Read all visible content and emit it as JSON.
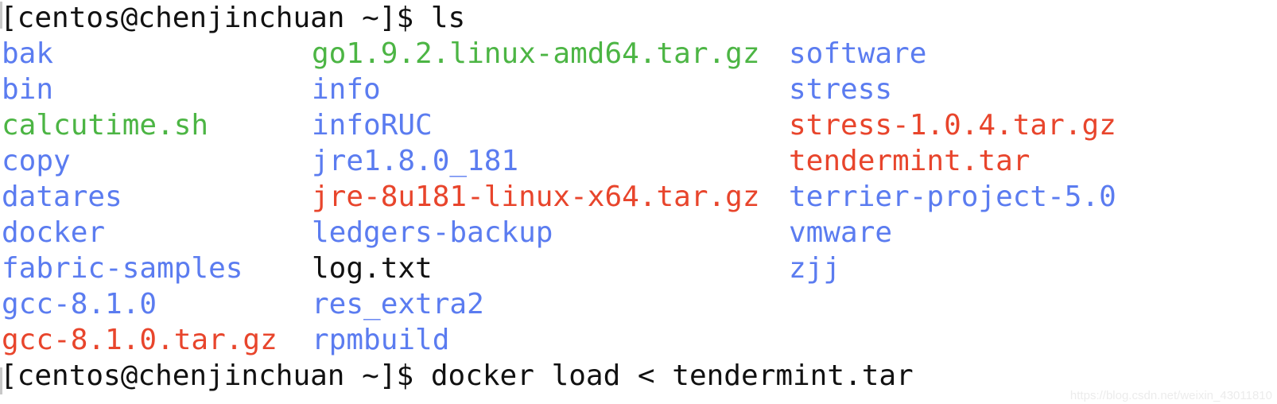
{
  "terminal": {
    "background_color": "#ffffff",
    "prompt_top": "[centos@chenjinchuan ~]$ ls",
    "prompt_bottom": "[centos@chenjinchuan ~]$ docker load < tendermint.tar",
    "colors": {
      "directory": "#5b7cf0",
      "executable": "#4cb544",
      "archive": "#e8452c",
      "plain_file": "#111111",
      "prompt_text": "#111111",
      "watermark": "#ececec"
    },
    "columns": [
      {
        "name": "column-1",
        "entries": [
          {
            "text": "bak",
            "kind": "directory"
          },
          {
            "text": "bin",
            "kind": "directory"
          },
          {
            "text": "calcutime.sh",
            "kind": "executable"
          },
          {
            "text": "copy",
            "kind": "directory"
          },
          {
            "text": "datares",
            "kind": "directory"
          },
          {
            "text": "docker",
            "kind": "directory"
          },
          {
            "text": "fabric-samples",
            "kind": "directory"
          },
          {
            "text": "gcc-8.1.0",
            "kind": "directory"
          },
          {
            "text": "gcc-8.1.0.tar.gz",
            "kind": "archive"
          }
        ]
      },
      {
        "name": "column-2",
        "entries": [
          {
            "text": "go1.9.2.linux-amd64.tar.gz",
            "kind": "executable"
          },
          {
            "text": "info",
            "kind": "directory"
          },
          {
            "text": "infoRUC",
            "kind": "directory"
          },
          {
            "text": "jre1.8.0_181",
            "kind": "directory"
          },
          {
            "text": "jre-8u181-linux-x64.tar.gz",
            "kind": "archive"
          },
          {
            "text": "ledgers-backup",
            "kind": "directory"
          },
          {
            "text": "log.txt",
            "kind": "plain_file"
          },
          {
            "text": "res_extra2",
            "kind": "directory"
          },
          {
            "text": "rpmbuild",
            "kind": "directory"
          }
        ]
      },
      {
        "name": "column-3",
        "entries": [
          {
            "text": "software",
            "kind": "directory"
          },
          {
            "text": "stress",
            "kind": "directory"
          },
          {
            "text": "stress-1.0.4.tar.gz",
            "kind": "archive"
          },
          {
            "text": "tendermint.tar",
            "kind": "archive"
          },
          {
            "text": "terrier-project-5.0",
            "kind": "directory"
          },
          {
            "text": "vmware",
            "kind": "directory"
          },
          {
            "text": "zjj",
            "kind": "directory"
          },
          {
            "text": "",
            "kind": "plain_file"
          },
          {
            "text": "",
            "kind": "plain_file"
          }
        ]
      }
    ]
  },
  "watermark": {
    "text": "https://blog.csdn.net/weixin_43011810"
  }
}
